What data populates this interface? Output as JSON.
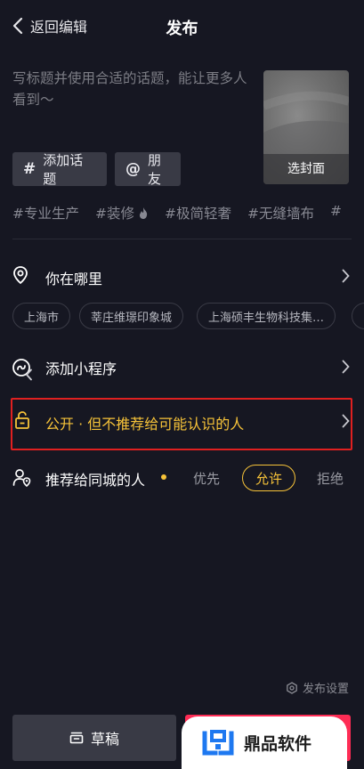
{
  "header": {
    "back_label": "返回编辑",
    "title": "发布"
  },
  "caption": {
    "placeholder": "写标题并使用合适的话题，能让更多人看到～"
  },
  "cover": {
    "label": "选封面"
  },
  "chips": {
    "add_topic": "添加话题",
    "mention": "朋友"
  },
  "tags": [
    "#专业生产",
    "#装修",
    "#极简轻奢",
    "#无缝墙布",
    "#"
  ],
  "location": {
    "label": "你在哪里",
    "suggestions": [
      "上海市",
      "莘庄维璟印象城",
      "上海硕丰生物科技集…",
      ""
    ]
  },
  "mini_program": {
    "label": "添加小程序"
  },
  "privacy": {
    "label": "公开 · 但不推荐给可能认识的人"
  },
  "recommend": {
    "label": "推荐给同城的人",
    "options": [
      "优先",
      "允许",
      "拒绝"
    ],
    "selected": "允许"
  },
  "footer": {
    "publish_settings": "发布设置",
    "draft_label": "草稿",
    "publish_label": ""
  },
  "watermark": {
    "text": "鼎品软件"
  },
  "colors": {
    "background": "#161722",
    "accent_yellow": "#f7c339",
    "publish_red": "#fe2c55",
    "highlight_border": "#e02020"
  }
}
